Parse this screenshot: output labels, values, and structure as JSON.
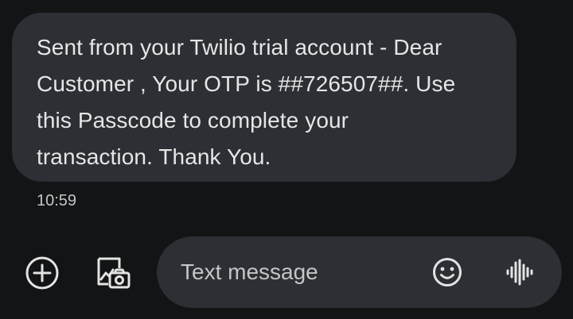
{
  "conversation": {
    "messages": [
      {
        "text": "Sent from your Twilio trial account - Dear\nCustomer , Your OTP is ##726507##. Use\nthis Passcode to complete your\ntransaction. Thank You.",
        "time": "10:59"
      }
    ]
  },
  "compose": {
    "placeholder": "Text message",
    "icons": {
      "add": "plus-circle-icon",
      "gallery": "gallery-camera-icon",
      "emoji": "smiley-icon",
      "voice": "voice-waveform-icon"
    }
  },
  "colors": {
    "background": "#131416",
    "bubble": "#2c2f33",
    "text": "#e6e6e6",
    "muted": "#c4c7c5"
  }
}
